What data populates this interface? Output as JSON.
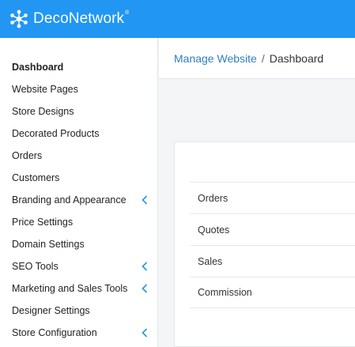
{
  "brand": {
    "name": "DecoNetwork",
    "reg_mark": "®"
  },
  "colors": {
    "header": "#2196f3",
    "link": "#2f7fc4",
    "chevron": "#2196f3"
  },
  "sidebar": {
    "items": [
      {
        "label": "Dashboard",
        "active": true,
        "expandable": false
      },
      {
        "label": "Website Pages",
        "expandable": false
      },
      {
        "label": "Store Designs",
        "expandable": false
      },
      {
        "label": "Decorated Products",
        "expandable": false
      },
      {
        "label": "Orders",
        "expandable": false
      },
      {
        "label": "Customers",
        "expandable": false
      },
      {
        "label": "Branding and Appearance",
        "expandable": true,
        "icon": "chevron-left-icon"
      },
      {
        "label": "Price Settings",
        "expandable": false
      },
      {
        "label": "Domain Settings",
        "expandable": false
      },
      {
        "label": "SEO Tools",
        "expandable": true,
        "icon": "chevron-left-icon"
      },
      {
        "label": "Marketing and Sales Tools",
        "expandable": true,
        "icon": "chevron-left-icon"
      },
      {
        "label": "Designer Settings",
        "expandable": false
      },
      {
        "label": "Store Configuration",
        "expandable": true,
        "icon": "chevron-left-icon"
      }
    ]
  },
  "breadcrumb": {
    "parent": "Manage Website",
    "separator": "/",
    "current": "Dashboard"
  },
  "panel": {
    "rows": [
      "Orders",
      "Quotes",
      "Sales",
      "Commission"
    ]
  }
}
